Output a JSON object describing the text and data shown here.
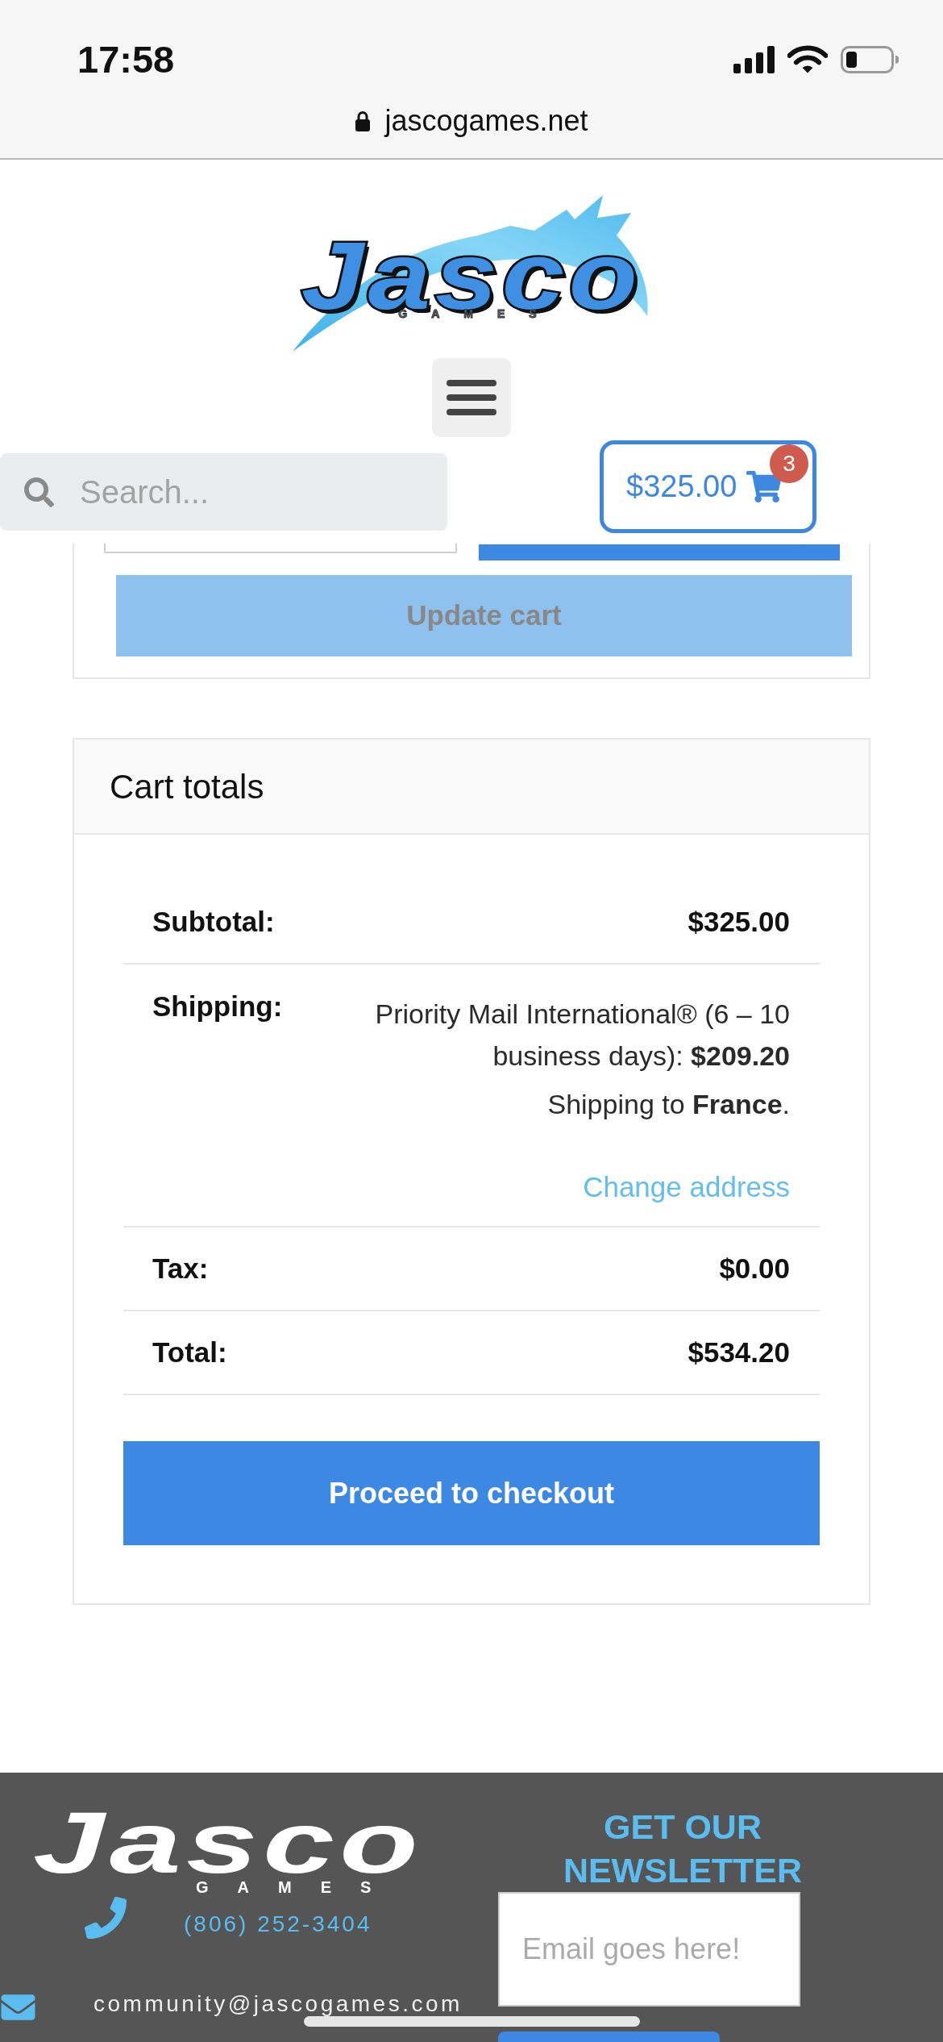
{
  "status_bar": {
    "time": "17:58"
  },
  "browser": {
    "address": "jascogames.net"
  },
  "header": {
    "logo": {
      "wordmark": "Jasco",
      "tagline": "GAMES"
    },
    "search": {
      "placeholder": "Search..."
    },
    "cart": {
      "amount": "$325.00",
      "count": "3"
    }
  },
  "cart_form": {
    "update_button": {
      "label": "Update cart",
      "disabled": true
    }
  },
  "cart_totals": {
    "title": "Cart totals",
    "rows": [
      {
        "kind": "amount",
        "label": "Subtotal:",
        "value": "$325.00"
      },
      {
        "kind": "shipping",
        "label": "Shipping:",
        "method": "Priority Mail International® (6 – 10 business days): **$209.20**",
        "destination": "Shipping to **France**.",
        "link": "Change address"
      },
      {
        "kind": "amount",
        "label": "Tax:",
        "value": "$0.00"
      },
      {
        "kind": "amount",
        "label": "Total:",
        "value": "$534.20"
      }
    ],
    "checkout_button": "Proceed to checkout"
  },
  "footer": {
    "logo": {
      "wordmark": "Jasco",
      "tagline": "GAMES"
    },
    "phone": "(806) 252-3404",
    "email": "community@jascogames.com",
    "newsletter": {
      "title": "GET OUR NEWSLETTER",
      "placeholder": "Email goes here!"
    }
  }
}
